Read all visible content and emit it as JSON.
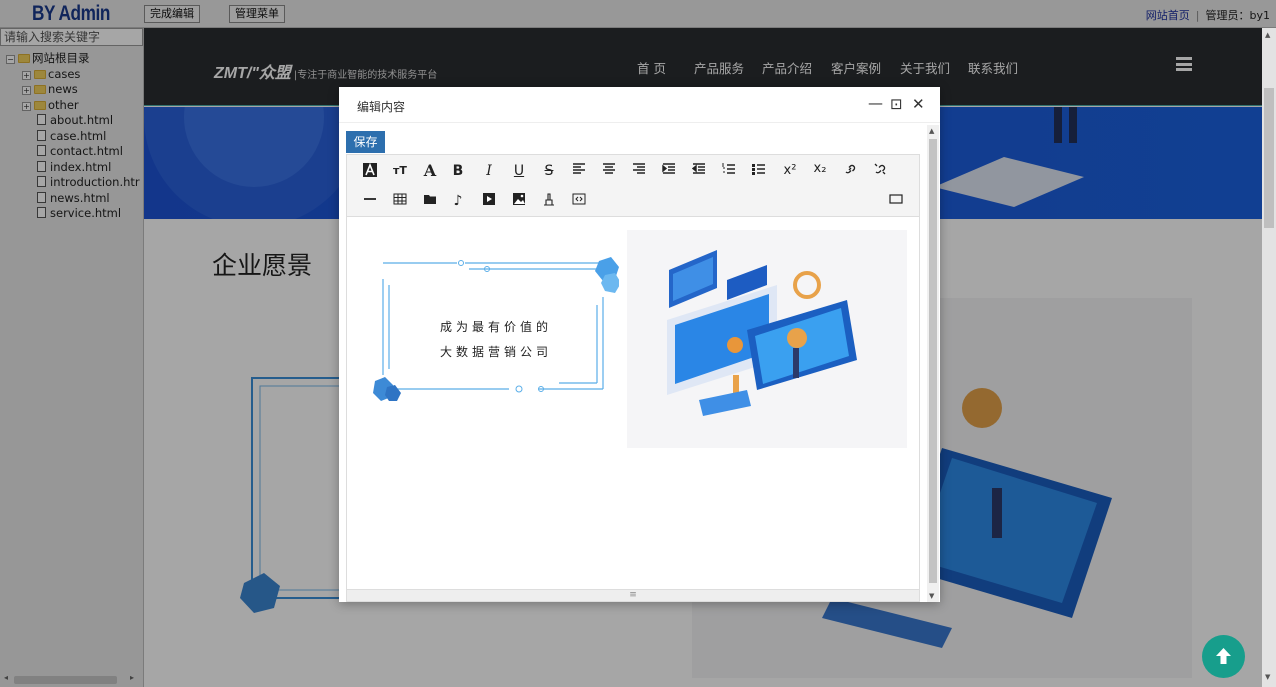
{
  "topbar": {
    "brand": "BY Admin",
    "done_edit": "完成编辑",
    "manage_menu": "管理菜单",
    "home_link": "网站首页",
    "separator": "|",
    "admin_label": "管理员：by1"
  },
  "sidebar": {
    "search_placeholder": "请输入搜索关键字",
    "root": "网站根目录",
    "folders": [
      "cases",
      "news",
      "other"
    ],
    "files": [
      "about.html",
      "case.html",
      "contact.html",
      "index.html",
      "introduction.htr",
      "news.html",
      "service.html"
    ]
  },
  "site": {
    "logo_text": "ZMT/\"众盟",
    "logo_tagline": "|专注于商业智能的技术服务平台",
    "nav": [
      "首 页",
      "产品服务",
      "产品介绍",
      "客户案例",
      "关于我们",
      "联系我们"
    ],
    "section_title": "企业愿景"
  },
  "modal": {
    "title": "编辑内容",
    "minimize": "—",
    "maximize": "⊡",
    "close": "✕",
    "save": "保存",
    "vision_line1": "成为最有价值的",
    "vision_line2": "大数据营销公司",
    "toolbar_icons": [
      "font-color-icon",
      "font-size-icon",
      "font-family-icon",
      "bold-icon",
      "italic-icon",
      "underline-icon",
      "strikethrough-icon",
      "align-left-icon",
      "align-center-icon",
      "align-right-icon",
      "indent-icon",
      "outdent-icon",
      "ordered-list-icon",
      "unordered-list-icon",
      "superscript-icon",
      "subscript-icon",
      "link-icon",
      "unlink-icon",
      "horizontal-rule-icon",
      "table-icon",
      "folder-icon",
      "music-icon",
      "video-icon",
      "image-icon",
      "clear-format-icon",
      "source-code-icon",
      "fullscreen-icon"
    ]
  },
  "colors": {
    "brand": "#1a3a8c",
    "nav_bg": "#2a2d31",
    "banner": "#1e54d6",
    "save_btn": "#2d6fae",
    "totop": "#179e8c"
  }
}
